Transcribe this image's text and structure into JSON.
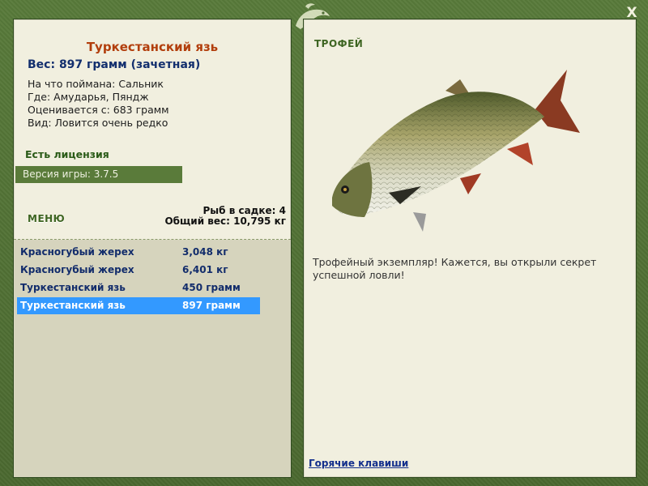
{
  "window": {
    "close_label": "X"
  },
  "colors": {
    "frame": "#4d6b33",
    "panel": "#f1efdf",
    "selection": "#3399ff",
    "title": "#b23e0c"
  },
  "fish": {
    "title": "Туркестанский язь",
    "weight": "Вес: 897 грамм (зачетная)",
    "bait": "На что поймана: Сальник",
    "location": "Где: Амударья, Пяндж",
    "rated": "Оценивается с: 683 грамм",
    "rarity": "Вид: Ловится очень редко"
  },
  "license_label": "Есть лицензия",
  "version_label": "Версия игры: 3.7.5",
  "menu_label": "МЕНЮ",
  "cage": {
    "count_label": "Рыб в садке: 4",
    "total_label": "Общий вес: 10,795 кг"
  },
  "catches": [
    {
      "name": "Красногубый жерех",
      "weight": "3,048 кг",
      "selected": false
    },
    {
      "name": "Красногубый жерех",
      "weight": "6,401 кг",
      "selected": false
    },
    {
      "name": "Туркестанский язь",
      "weight": "450 грамм",
      "selected": false
    },
    {
      "name": "Туркестанский язь",
      "weight": "897 грамм",
      "selected": true
    }
  ],
  "trophy": {
    "label": "ТРОФЕЙ",
    "text": "Трофейный экземпляр! Кажется, вы открыли секрет успешной ловли!"
  },
  "hotkeys_label": "Горячие клавиши",
  "icons": {
    "close": "close-icon",
    "logo": "fish-logo-icon"
  }
}
